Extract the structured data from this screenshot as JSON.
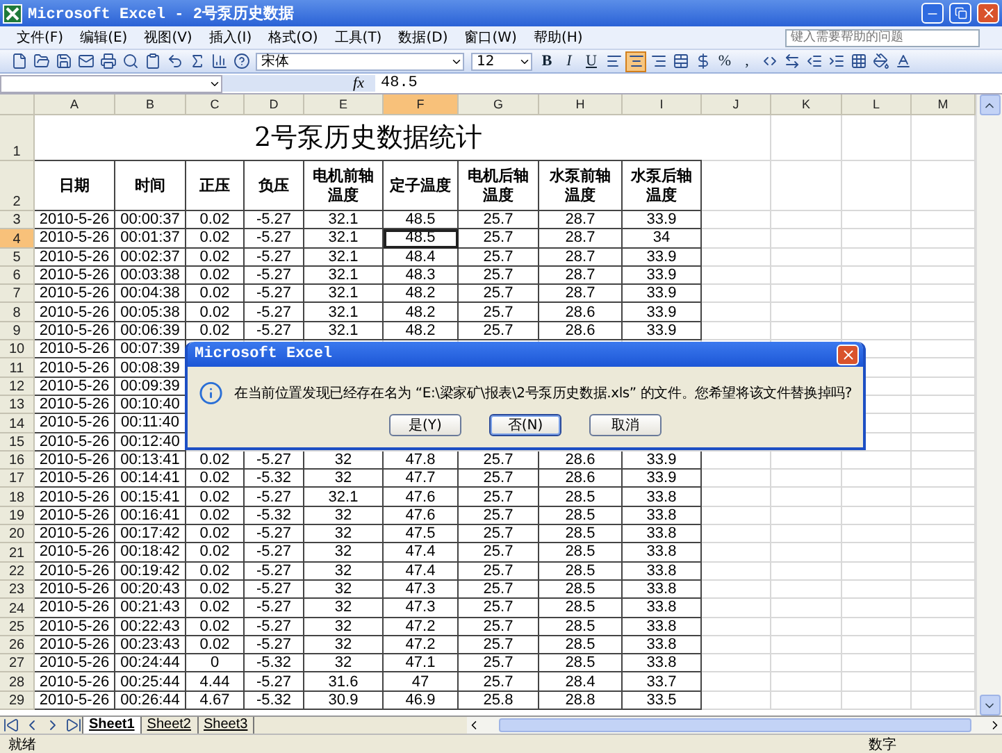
{
  "window": {
    "title": "Microsoft Excel - 2号泵历史数据"
  },
  "menu": [
    {
      "label": "文件(F)"
    },
    {
      "label": "编辑(E)"
    },
    {
      "label": "视图(V)"
    },
    {
      "label": "插入(I)"
    },
    {
      "label": "格式(O)"
    },
    {
      "label": "工具(T)"
    },
    {
      "label": "数据(D)"
    },
    {
      "label": "窗口(W)"
    },
    {
      "label": "帮助(H)"
    }
  ],
  "help_search": {
    "placeholder": "键入需要帮助的问题"
  },
  "formatting": {
    "font": "宋体",
    "size": "12",
    "styles": [
      {
        "kind": "bold",
        "label": "B"
      },
      {
        "kind": "italic",
        "label": "I"
      },
      {
        "kind": "underline",
        "label": "U"
      }
    ],
    "alignment": [
      {
        "kind": "left",
        "selected": false
      },
      {
        "kind": "center",
        "selected": true
      },
      {
        "kind": "right",
        "selected": false
      },
      {
        "kind": "merge",
        "selected": false
      }
    ],
    "number_buttons": [
      "%",
      ","
    ]
  },
  "formula_bar": {
    "function_label": "fx",
    "value": "48.5"
  },
  "columns": [
    {
      "label": "A",
      "selected": false
    },
    {
      "label": "B",
      "selected": false
    },
    {
      "label": "C",
      "selected": false
    },
    {
      "label": "D",
      "selected": false
    },
    {
      "label": "E",
      "selected": false
    },
    {
      "label": "F",
      "selected": true
    },
    {
      "label": "G",
      "selected": false
    },
    {
      "label": "H",
      "selected": false
    },
    {
      "label": "I",
      "selected": false
    },
    {
      "label": "J",
      "selected": false
    },
    {
      "label": "K",
      "selected": false
    },
    {
      "label": "L",
      "selected": false
    },
    {
      "label": "M",
      "selected": false
    }
  ],
  "sheet": {
    "title_row": "1",
    "title": "2号泵历史数据统计",
    "header_row": "2",
    "headers": [
      "日期",
      "时间",
      "正压",
      "负压",
      "电机前轴温度",
      "定子温度",
      "电机后轴温度",
      "水泵前轴温度",
      "水泵后轴温度"
    ],
    "rows": [
      {
        "number": "3",
        "selected": false,
        "cells": [
          "2010-5-26",
          "00:00:37",
          "0.02",
          "-5.27",
          "32.1",
          "48.5",
          "25.7",
          "28.7",
          "33.9"
        ]
      },
      {
        "number": "4",
        "selected": true,
        "cells": [
          "2010-5-26",
          "00:01:37",
          "0.02",
          "-5.27",
          "32.1",
          "48.5",
          "25.7",
          "28.7",
          "34"
        ]
      },
      {
        "number": "5",
        "selected": false,
        "cells": [
          "2010-5-26",
          "00:02:37",
          "0.02",
          "-5.27",
          "32.1",
          "48.4",
          "25.7",
          "28.7",
          "33.9"
        ]
      },
      {
        "number": "6",
        "selected": false,
        "cells": [
          "2010-5-26",
          "00:03:38",
          "0.02",
          "-5.27",
          "32.1",
          "48.3",
          "25.7",
          "28.7",
          "33.9"
        ]
      },
      {
        "number": "7",
        "selected": false,
        "cells": [
          "2010-5-26",
          "00:04:38",
          "0.02",
          "-5.27",
          "32.1",
          "48.2",
          "25.7",
          "28.7",
          "33.9"
        ]
      },
      {
        "number": "8",
        "selected": false,
        "cells": [
          "2010-5-26",
          "00:05:38",
          "0.02",
          "-5.27",
          "32.1",
          "48.2",
          "25.7",
          "28.6",
          "33.9"
        ]
      },
      {
        "number": "9",
        "selected": false,
        "cells": [
          "2010-5-26",
          "00:06:39",
          "0.02",
          "-5.27",
          "32.1",
          "48.2",
          "25.7",
          "28.6",
          "33.9"
        ]
      },
      {
        "number": "10",
        "selected": false,
        "cells": [
          "2010-5-26",
          "00:07:39"
        ]
      },
      {
        "number": "11",
        "selected": false,
        "cells": [
          "2010-5-26",
          "00:08:39"
        ]
      },
      {
        "number": "12",
        "selected": false,
        "cells": [
          "2010-5-26",
          "00:09:39"
        ]
      },
      {
        "number": "13",
        "selected": false,
        "cells": [
          "2010-5-26",
          "00:10:40"
        ]
      },
      {
        "number": "14",
        "selected": false,
        "cells": [
          "2010-5-26",
          "00:11:40"
        ]
      },
      {
        "number": "15",
        "selected": false,
        "cells": [
          "2010-5-26",
          "00:12:40"
        ]
      },
      {
        "number": "16",
        "selected": false,
        "cells": [
          "2010-5-26",
          "00:13:41",
          "0.02",
          "-5.27",
          "32",
          "47.8",
          "25.7",
          "28.6",
          "33.9"
        ]
      },
      {
        "number": "17",
        "selected": false,
        "cells": [
          "2010-5-26",
          "00:14:41",
          "0.02",
          "-5.32",
          "32",
          "47.7",
          "25.7",
          "28.6",
          "33.9"
        ]
      },
      {
        "number": "18",
        "selected": false,
        "cells": [
          "2010-5-26",
          "00:15:41",
          "0.02",
          "-5.27",
          "32.1",
          "47.6",
          "25.7",
          "28.5",
          "33.8"
        ]
      },
      {
        "number": "19",
        "selected": false,
        "cells": [
          "2010-5-26",
          "00:16:41",
          "0.02",
          "-5.32",
          "32",
          "47.6",
          "25.7",
          "28.5",
          "33.8"
        ]
      },
      {
        "number": "20",
        "selected": false,
        "cells": [
          "2010-5-26",
          "00:17:42",
          "0.02",
          "-5.27",
          "32",
          "47.5",
          "25.7",
          "28.5",
          "33.8"
        ]
      },
      {
        "number": "21",
        "selected": false,
        "cells": [
          "2010-5-26",
          "00:18:42",
          "0.02",
          "-5.27",
          "32",
          "47.4",
          "25.7",
          "28.5",
          "33.8"
        ]
      },
      {
        "number": "22",
        "selected": false,
        "cells": [
          "2010-5-26",
          "00:19:42",
          "0.02",
          "-5.27",
          "32",
          "47.4",
          "25.7",
          "28.5",
          "33.8"
        ]
      },
      {
        "number": "23",
        "selected": false,
        "cells": [
          "2010-5-26",
          "00:20:43",
          "0.02",
          "-5.27",
          "32",
          "47.3",
          "25.7",
          "28.5",
          "33.8"
        ]
      },
      {
        "number": "24",
        "selected": false,
        "cells": [
          "2010-5-26",
          "00:21:43",
          "0.02",
          "-5.27",
          "32",
          "47.3",
          "25.7",
          "28.5",
          "33.8"
        ]
      },
      {
        "number": "25",
        "selected": false,
        "cells": [
          "2010-5-26",
          "00:22:43",
          "0.02",
          "-5.27",
          "32",
          "47.2",
          "25.7",
          "28.5",
          "33.8"
        ]
      },
      {
        "number": "26",
        "selected": false,
        "cells": [
          "2010-5-26",
          "00:23:43",
          "0.02",
          "-5.27",
          "32",
          "47.2",
          "25.7",
          "28.5",
          "33.8"
        ]
      },
      {
        "number": "27",
        "selected": false,
        "cells": [
          "2010-5-26",
          "00:24:44",
          "0",
          "-5.32",
          "32",
          "47.1",
          "25.7",
          "28.5",
          "33.8"
        ]
      },
      {
        "number": "28",
        "selected": false,
        "cells": [
          "2010-5-26",
          "00:25:44",
          "4.44",
          "-5.27",
          "31.6",
          "47",
          "25.7",
          "28.4",
          "33.7"
        ]
      },
      {
        "number": "29",
        "selected": false,
        "cells": [
          "2010-5-26",
          "00:26:44",
          "4.67",
          "-5.32",
          "30.9",
          "46.9",
          "25.8",
          "28.8",
          "33.5"
        ]
      }
    ]
  },
  "dialog": {
    "title": "Microsoft Excel",
    "message": "在当前位置发现已经存在名为 “E:\\梁家矿\\报表\\2号泵历史数据.xls” 的文件。您希望将该文件替换掉吗?",
    "buttons": [
      {
        "label": "是(Y)",
        "selected": false
      },
      {
        "label": "否(N)",
        "selected": true
      },
      {
        "label": "取消",
        "selected": false
      }
    ]
  },
  "sheet_tabs": [
    {
      "label": "Sheet1",
      "selected": true
    },
    {
      "label": "Sheet2",
      "selected": false
    },
    {
      "label": "Sheet3",
      "selected": false
    }
  ],
  "status_bar": {
    "status": "就绪",
    "mode": "数字"
  }
}
